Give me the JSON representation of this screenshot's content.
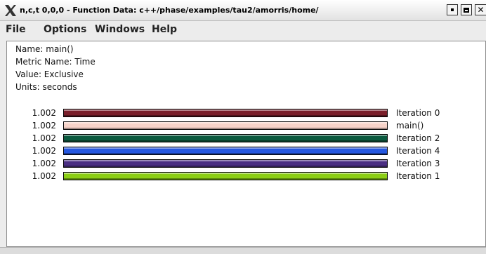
{
  "window": {
    "title": "n,c,t 0,0,0 - Function Data: c++/phase/examples/tau2/amorris/home/"
  },
  "menu": [
    "File",
    "Options",
    "Windows",
    "Help"
  ],
  "info": {
    "name": "Name: main()",
    "metric": "Metric Name: Time",
    "value": "Value: Exclusive",
    "units": "Units: seconds"
  },
  "bars": [
    {
      "value": "1.002",
      "label": "Iteration 0",
      "fraction": 1.0,
      "color": "#7a1e2a"
    },
    {
      "value": "1.002",
      "label": "main()",
      "fraction": 1.0,
      "color": "#f7d3c9"
    },
    {
      "value": "1.002",
      "label": "Iteration 2",
      "fraction": 1.0,
      "color": "#0b5a3f"
    },
    {
      "value": "1.002",
      "label": "Iteration 4",
      "fraction": 1.0,
      "color": "#2457e0"
    },
    {
      "value": "1.002",
      "label": "Iteration 3",
      "fraction": 1.0,
      "color": "#4a2e82"
    },
    {
      "value": "1.002",
      "label": "Iteration 1",
      "fraction": 1.0,
      "color": "#8ccf14"
    }
  ]
}
